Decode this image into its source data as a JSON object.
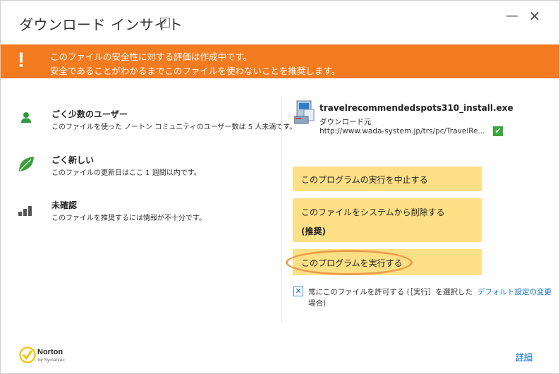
{
  "window": {
    "title": "ダウンロード インサイト",
    "help_label": "?",
    "minimize_glyph": "—",
    "close_glyph": "✕"
  },
  "banner": {
    "line1": "このファイルの安全性に対する評価は作成中です。",
    "line2": "安全であることがわかるまでこのファイルを使わないことを推奨します。",
    "icon": "exclamation-icon",
    "color": "#f47b20"
  },
  "info": [
    {
      "icon": "user-icon",
      "heading": "ごく少数のユーザー",
      "desc": "このファイルを使った ノートン コミュニティのユーザー数は 5 人未満です。"
    },
    {
      "icon": "leaf-icon",
      "heading": "ごく新しい",
      "desc": "このファイルの更新日はここ 1 週間以内です。"
    },
    {
      "icon": "signal-bars-icon",
      "heading": "未確認",
      "desc": "このファイルを推奨するには情報が不十分です。"
    }
  ],
  "file": {
    "name": "travelrecommendedspots310_install.exe",
    "source_label": "ダウンロード元",
    "url": "http://www.wada-system.jp/trs/pc/TravelRe...",
    "verified_glyph": "✔"
  },
  "actions": {
    "stop": "このプログラムの実行を中止する",
    "remove_line1": "このファイルをシステムから削除する",
    "remove_line2": "(推奨)",
    "run": "このプログラムを実行する",
    "button_color": "#fde086"
  },
  "allow": {
    "checked_glyph": "✕",
    "text_line1": "常にこのファイルを許可する (［実行］を選択した",
    "text_line2": "場合)",
    "default_link": "デフォルト設定の変更"
  },
  "footer": {
    "brand": "Norton",
    "brand_sub": "by Symantec",
    "details_link": "詳細"
  }
}
